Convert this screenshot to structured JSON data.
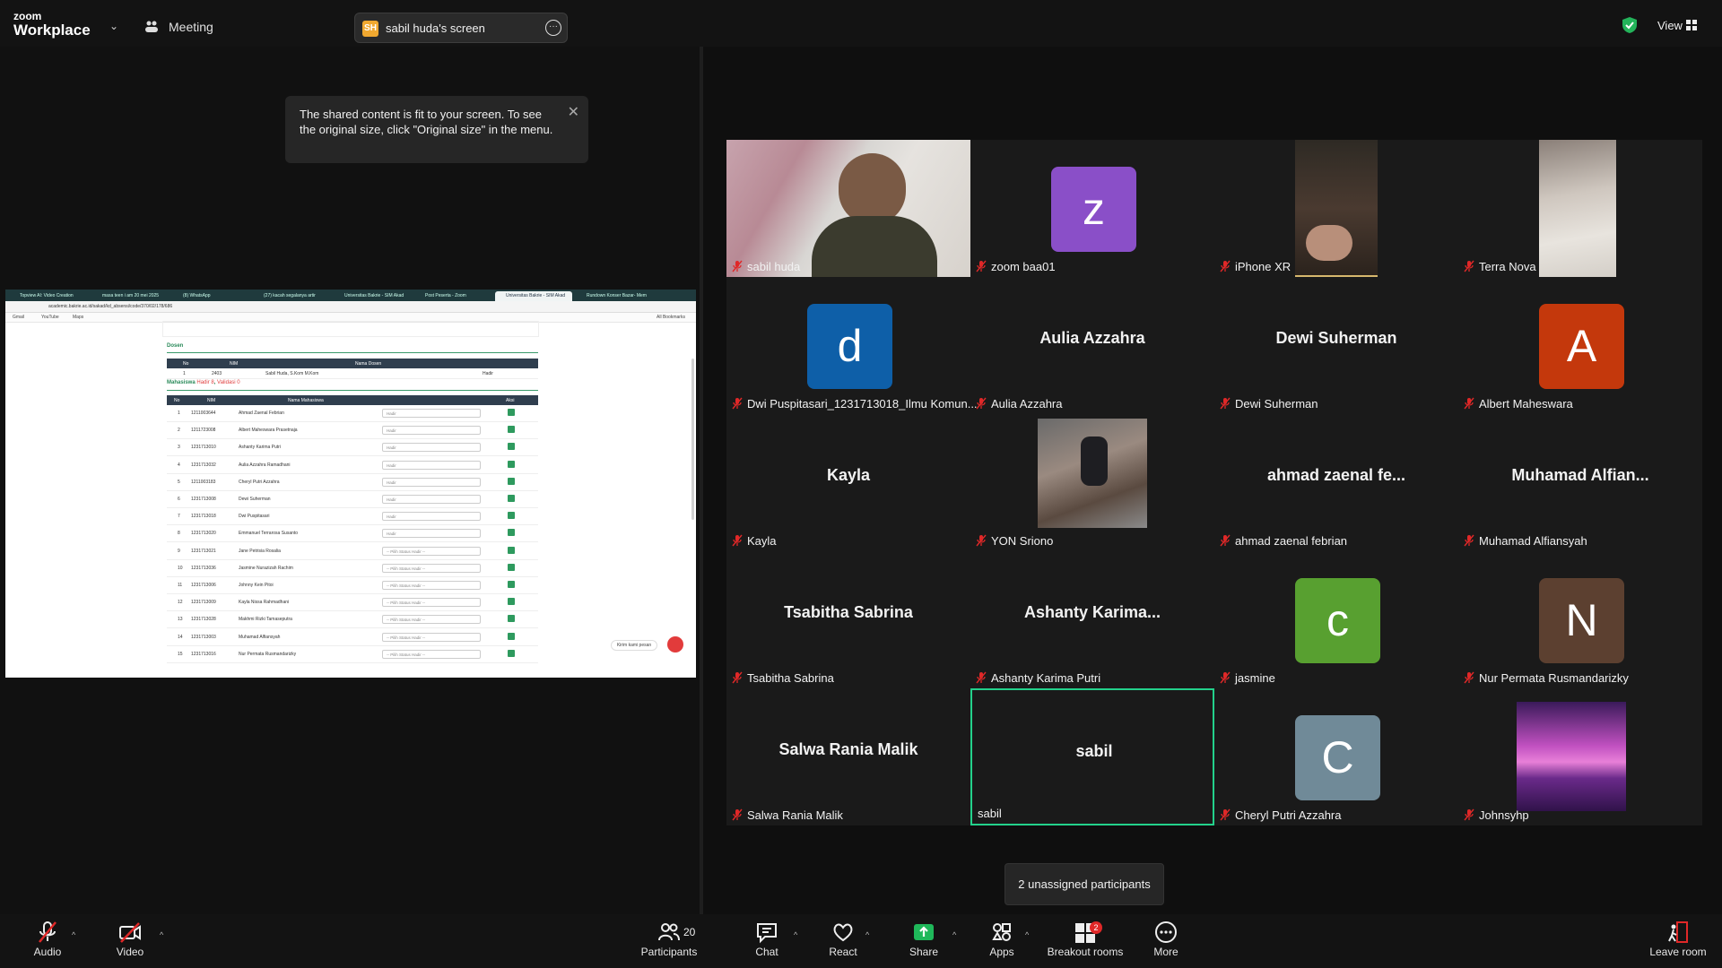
{
  "topbar": {
    "logo_line1": "zoom",
    "logo_line2": "Workplace",
    "meeting_label": "Meeting",
    "share_badge": "SH",
    "share_label": "sabil huda's screen",
    "view_label": "View"
  },
  "tooltip": {
    "text": "The shared content is fit to your screen. To see the original size, click \"Original size\" in the menu."
  },
  "shared_screen": {
    "tabs": [
      "Topview AI: Video Creation",
      "masa teen i am 20 mei 2025",
      "(8) WhatsApp",
      "(27) kacah segalanya artir",
      "Universitas Bakrie - SIM Akad",
      "Post Peserta - Zoom",
      "Universitas Bakrie - SIM Akad",
      "Rundown Konser Bazar- Mem"
    ],
    "address": "academic.bakrie.ac.id/sakad/kd_absensi/code/370/02/178/686",
    "bookmarks": [
      "Gmail",
      "YouTube",
      "Maps"
    ],
    "bookmarks_right": "All Bookmarks",
    "dosen_heading": "Dosen",
    "dosen_headers": [
      "No",
      "NIM",
      "Nama Dosen"
    ],
    "dosen_row": [
      "1",
      "2403",
      "Sabil Huda, S.Kom M.Kom",
      "Hadir"
    ],
    "mhs_heading": "Mahasiswa",
    "mhs_hadir": "Hadir 8",
    "mhs_validasi": "Validasi 0",
    "mhs_headers": [
      "No",
      "NIM",
      "Nama Mahasiswa",
      "Aksi"
    ],
    "rows": [
      {
        "no": "1",
        "nim": "1211003644",
        "name": "Ahmad Zaenal Febrian",
        "status": "Hadir"
      },
      {
        "no": "2",
        "nim": "1211723008",
        "name": "Albert Maheswara Prasetnaja",
        "status": "Hadir"
      },
      {
        "no": "3",
        "nim": "1231713010",
        "name": "Ashanty Karima Putri",
        "status": "Hadir"
      },
      {
        "no": "4",
        "nim": "1231713032",
        "name": "Aulia Azzahra Ramadhani",
        "status": "Hadir"
      },
      {
        "no": "5",
        "nim": "1211003183",
        "name": "Cheryl Putri Azzahra",
        "status": "Hadir"
      },
      {
        "no": "6",
        "nim": "1231713008",
        "name": "Dewi Suherman",
        "status": "Hadir"
      },
      {
        "no": "7",
        "nim": "1231713018",
        "name": "Dwi Puspitasari",
        "status": "Hadir"
      },
      {
        "no": "8",
        "nim": "1231713020",
        "name": "Emmanuel Terrarosa Susanto",
        "status": "Hadir"
      },
      {
        "no": "9",
        "nim": "1231713021",
        "name": "Jane Petrisia Rosalia",
        "status": "-- Pilih Status Hadir --"
      },
      {
        "no": "10",
        "nim": "1231713036",
        "name": "Jasmine Nurazizah Rachim",
        "status": "-- Pilih Status Hadir --"
      },
      {
        "no": "11",
        "nim": "1231713006",
        "name": "Johnny Kein Pitoi",
        "status": "-- Pilih Status Hadir --"
      },
      {
        "no": "12",
        "nim": "1231713009",
        "name": "Kayla Nissa Rahmadhani",
        "status": "-- Pilih Status Hadir --"
      },
      {
        "no": "13",
        "nim": "1231713028",
        "name": "Makhmi Rizki Tamaseputra",
        "status": "-- Pilih Status Hadir --"
      },
      {
        "no": "14",
        "nim": "1231713003",
        "name": "Muhamad Alfiansyah",
        "status": "-- Pilih Status Hadir --"
      },
      {
        "no": "15",
        "nim": "1231713016",
        "name": "Nur Permata Rusmandarizky",
        "status": "-- Pilih Status Hadir --"
      }
    ],
    "chat_pill": "Kirim kami pesan"
  },
  "participants_grid": [
    {
      "label": "sabil huda",
      "type": "video"
    },
    {
      "label": "zoom baa01",
      "type": "avatar",
      "letter": "z",
      "color": "#8a4fc8"
    },
    {
      "label": "iPhone XR",
      "type": "video"
    },
    {
      "label": "Terra Nova",
      "type": "video"
    },
    {
      "label": "Dwi Puspitasari_1231713018_Ilmu Komun...",
      "type": "avatar",
      "letter": "d",
      "color": "#0e5fa8"
    },
    {
      "label": "Aulia Azzahra",
      "type": "name",
      "big": "Aulia Azzahra"
    },
    {
      "label": "Dewi Suherman",
      "type": "name",
      "big": "Dewi Suherman"
    },
    {
      "label": "Albert Maheswara",
      "type": "avatar",
      "letter": "A",
      "color": "#c4380c"
    },
    {
      "label": "Kayla",
      "type": "name",
      "big": "Kayla"
    },
    {
      "label": "YON Sriono",
      "type": "photo"
    },
    {
      "label": "ahmad zaenal febrian",
      "type": "name",
      "big": "ahmad  zaenal  fe..."
    },
    {
      "label": "Muhamad Alfiansyah",
      "type": "name",
      "big": "Muhamad  Alfian..."
    },
    {
      "label": "Tsabitha Sabrina",
      "type": "name",
      "big": "Tsabitha Sabrina"
    },
    {
      "label": "Ashanty Karima Putri",
      "type": "name",
      "big": "Ashanty  Karima..."
    },
    {
      "label": "jasmine",
      "type": "avatar",
      "letter": "c",
      "color": "#58a030"
    },
    {
      "label": "Nur Permata Rusmandarizky",
      "type": "avatar",
      "letter": "N",
      "color": "#5c4030"
    },
    {
      "label": "Salwa Rania Malik",
      "type": "name",
      "big": "Salwa Rania Malik"
    },
    {
      "label": "sabil",
      "type": "name",
      "big": "sabil",
      "active": true
    },
    {
      "label": "Cheryl Putri Azzahra",
      "type": "avatar",
      "letter": "C",
      "color": "#708a98"
    },
    {
      "label": "Johnsyhp",
      "type": "photo"
    }
  ],
  "unassigned": "2 unassigned participants",
  "toolbar": {
    "audio": "Audio",
    "video": "Video",
    "participants": "Participants",
    "participants_count": "20",
    "chat": "Chat",
    "react": "React",
    "share": "Share",
    "apps": "Apps",
    "breakout": "Breakout rooms",
    "breakout_badge": "2",
    "more": "More",
    "leave": "Leave room"
  },
  "colors": {
    "accent_green": "#23d18b",
    "share_green": "#1fb85a",
    "mute_red": "#e02828"
  }
}
